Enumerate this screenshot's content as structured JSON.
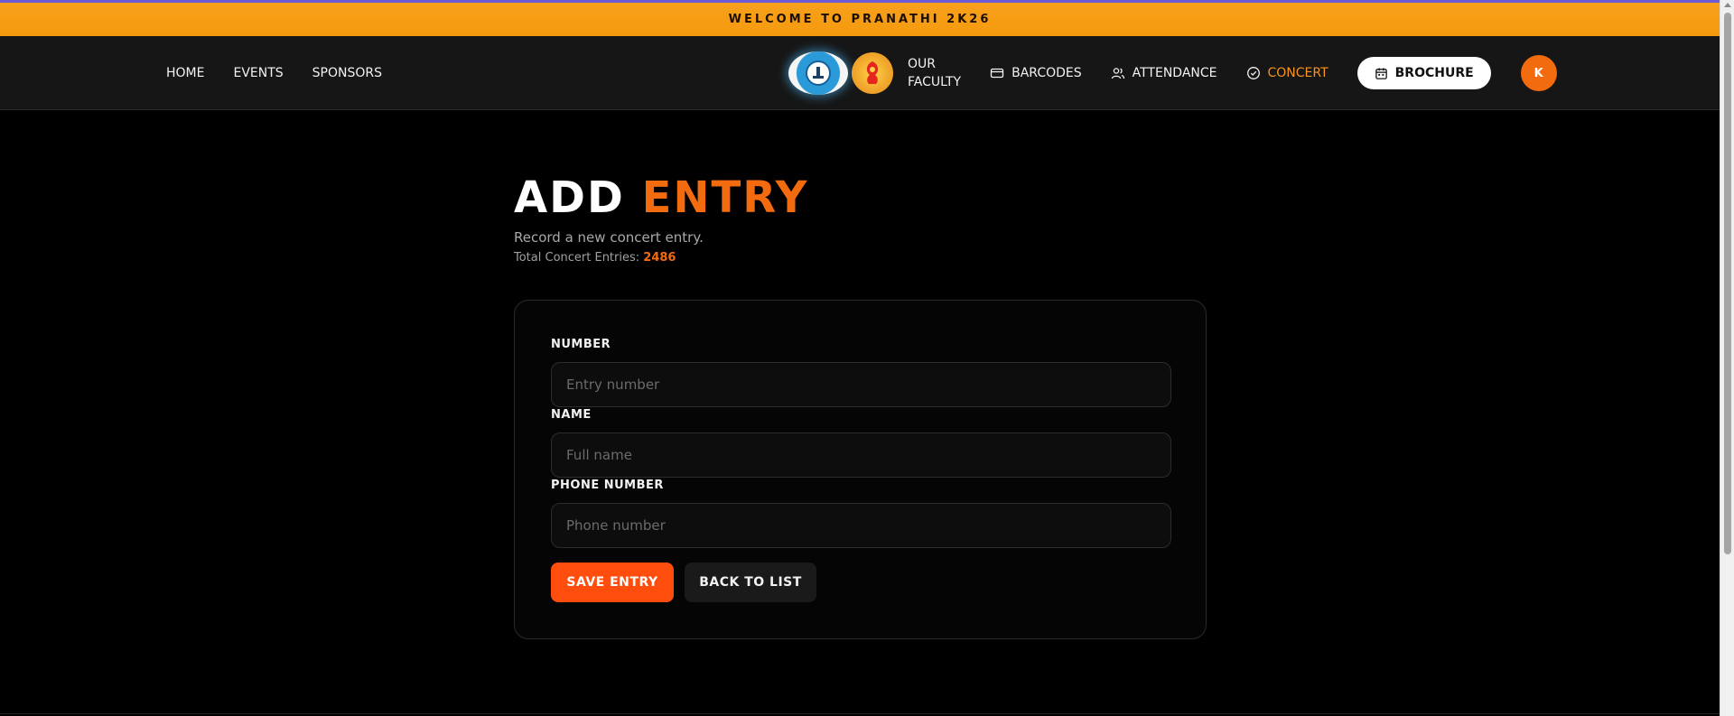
{
  "banner": {
    "text": "WELCOME TO PRANATHI 2K26"
  },
  "nav": {
    "left_links": [
      "HOME",
      "EVENTS",
      "SPONSORS"
    ],
    "faculty_line1": "OUR",
    "faculty_line2": "FACULTY",
    "barcodes": "BARCODES",
    "attendance": "ATTENDANCE",
    "concert": "CONCERT",
    "brochure": "BROCHURE",
    "avatar_initial": "K"
  },
  "page": {
    "title_part1": "ADD",
    "title_part2": "ENTRY",
    "subtitle": "Record a new concert entry.",
    "counter_label": "Total Concert Entries:",
    "counter_value": "2486"
  },
  "form": {
    "number_label": "NUMBER",
    "number_placeholder": "Entry number",
    "name_label": "NAME",
    "name_placeholder": "Full name",
    "phone_label": "PHONE NUMBER",
    "phone_placeholder": "Phone number",
    "save_label": "SAVE ENTRY",
    "back_label": "BACK TO LIST"
  },
  "icons": {
    "barcodes": "card-icon",
    "attendance": "users-icon",
    "concert": "check-circle-icon",
    "brochure": "calendar-icon"
  },
  "colors": {
    "accent": "#f26b0f",
    "banner": "#f7a01a",
    "save_button": "#ff4d0d",
    "active_nav": "#f7931e"
  }
}
